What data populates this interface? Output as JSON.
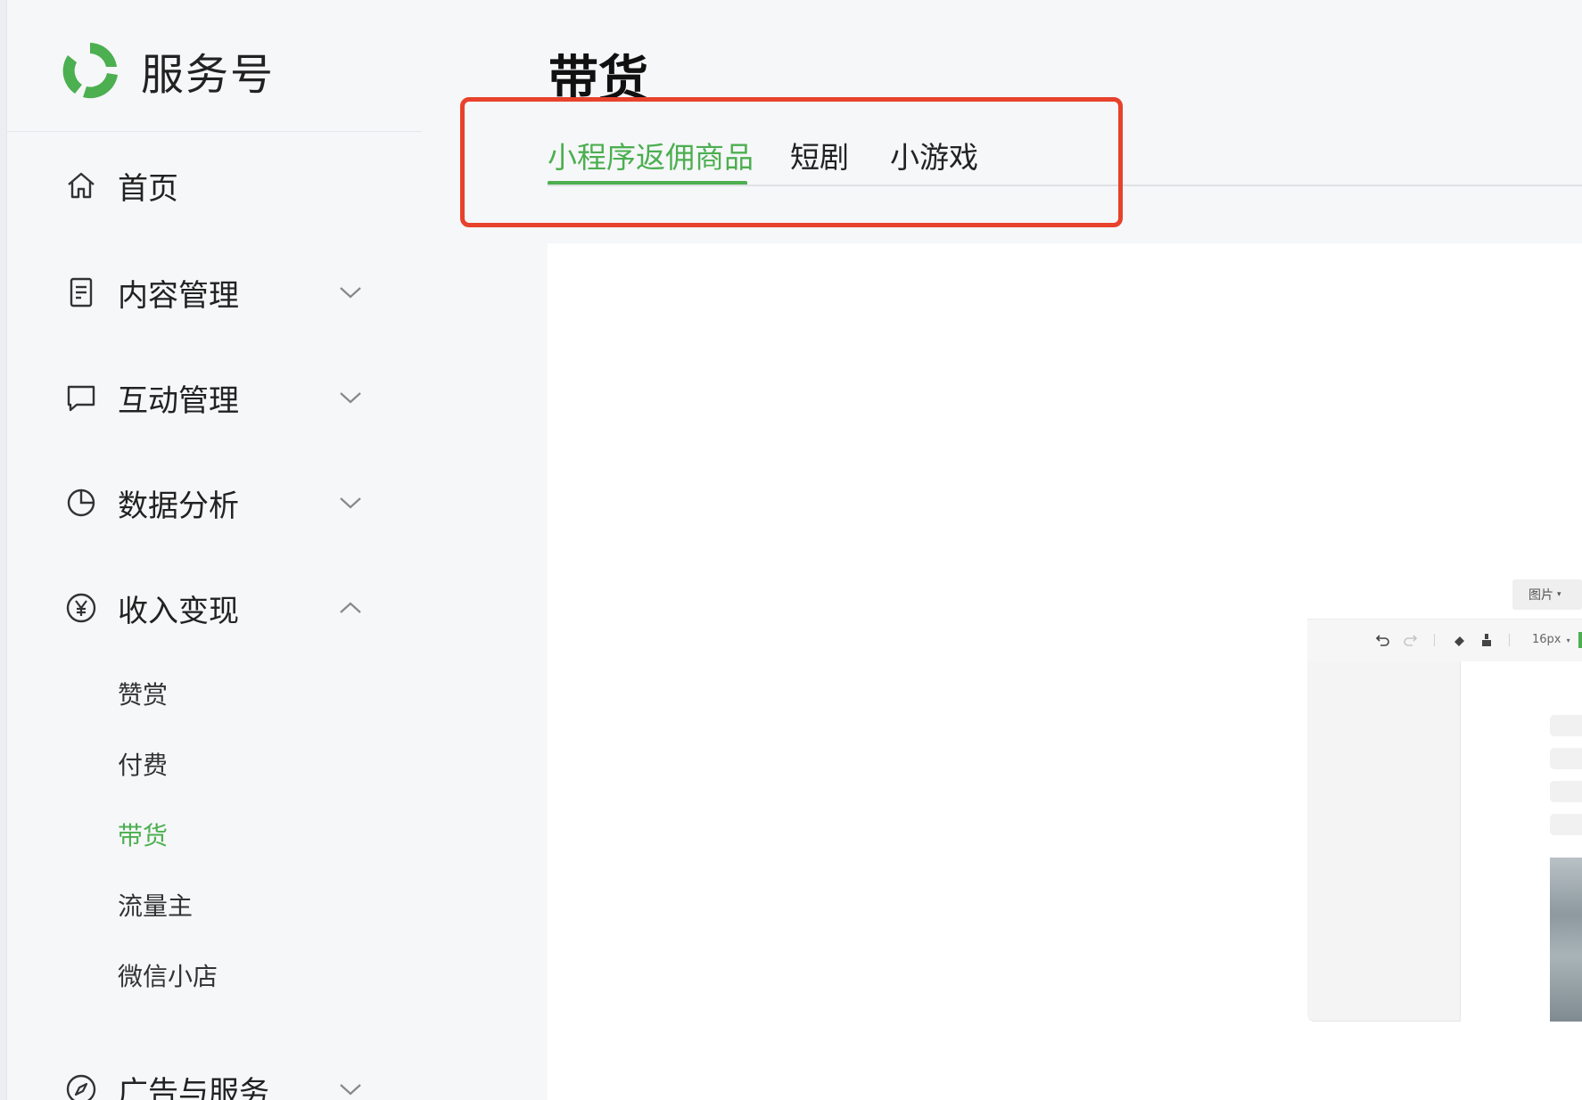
{
  "brand": {
    "name": "服务号",
    "logo_icon": "service-account-logo",
    "logo_color": "#4caf50"
  },
  "sidebar": {
    "items": [
      {
        "label": "首页",
        "icon": "home-icon"
      },
      {
        "label": "内容管理",
        "icon": "document-icon",
        "chevron": "chevron-down-icon"
      },
      {
        "label": "互动管理",
        "icon": "chat-bubble-icon",
        "chevron": "chevron-down-icon"
      },
      {
        "label": "数据分析",
        "icon": "pie-chart-icon",
        "chevron": "chevron-down-icon"
      },
      {
        "label": "收入变现",
        "icon": "yen-coin-icon",
        "chevron": "chevron-up-icon",
        "expanded": true
      },
      {
        "label": "广告与服务",
        "icon": "compass-icon",
        "chevron": "chevron-down-icon"
      }
    ],
    "sub_items": [
      {
        "label": "赞赏"
      },
      {
        "label": "付费"
      },
      {
        "label": "带货",
        "active": true
      },
      {
        "label": "流量主"
      },
      {
        "label": "微信小店"
      }
    ]
  },
  "page": {
    "title": "带货"
  },
  "tabs": [
    {
      "label": "小程序返佣商品",
      "active": true
    },
    {
      "label": "短剧"
    },
    {
      "label": "小游戏"
    }
  ],
  "preview": {
    "tag_label": "图片",
    "font_size_label": "16px"
  },
  "colors": {
    "accent": "#4caf50",
    "highlight": "#e8412c",
    "background": "#f6f7f9"
  }
}
